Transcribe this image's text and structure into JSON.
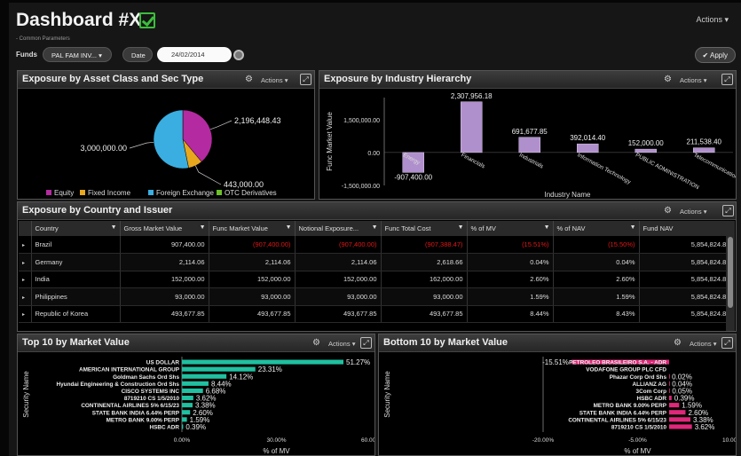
{
  "header": {
    "title": "Dashboard #X",
    "actions_label": "Actions"
  },
  "params": {
    "common_label": "Common Parameters",
    "funds_label": "Funds",
    "funds_value": "PAL FAM INV...",
    "date_label": "Date",
    "date_value": "24/02/2014",
    "apply_label": "Apply"
  },
  "panels": {
    "asset": {
      "title": "Exposure by Asset Class and Sec Type",
      "actions": "Actions"
    },
    "industry": {
      "title": "Exposure by Industry Hierarchy",
      "actions": "Actions"
    },
    "country": {
      "title": "Exposure by Country and Issuer",
      "actions": "Actions"
    },
    "top10": {
      "title": "Top 10 by Market Value",
      "actions": "Actions"
    },
    "bottom10": {
      "title": "Bottom 10 by Market Value",
      "actions": "Actions"
    }
  },
  "colors": {
    "equity": "#b42aa0",
    "fixed_income": "#e8a81e",
    "fx": "#3aaee0",
    "otc": "#6cc027",
    "industry_bar": "#b090cc",
    "top_bar": "#20c0a0",
    "bottom_bar": "#e0287a"
  },
  "table": {
    "columns": [
      "Country",
      "Gross Market Value",
      "Func Market Value",
      "Notional Exposure...",
      "Func Total Cost",
      "% of MV",
      "% of NAV",
      "Fund NAV"
    ],
    "rows": [
      {
        "country": "Brazil",
        "gmv": "907,400.00",
        "fmv": "(907,400.00)",
        "notional": "(907,400.00)",
        "cost": "(907,388.47)",
        "pmv": "(15.51%)",
        "pnav": "(15.50%)",
        "nav": "5,854,824.82",
        "neg": true
      },
      {
        "country": "Germany",
        "gmv": "2,114.06",
        "fmv": "2,114.06",
        "notional": "2,114.06",
        "cost": "2,618.66",
        "pmv": "0.04%",
        "pnav": "0.04%",
        "nav": "5,854,824.82",
        "neg": false
      },
      {
        "country": "India",
        "gmv": "152,000.00",
        "fmv": "152,000.00",
        "notional": "152,000.00",
        "cost": "162,000.00",
        "pmv": "2.60%",
        "pnav": "2.60%",
        "nav": "5,854,824.82",
        "neg": false
      },
      {
        "country": "Philippines",
        "gmv": "93,000.00",
        "fmv": "93,000.00",
        "notional": "93,000.00",
        "cost": "93,000.00",
        "pmv": "1.59%",
        "pnav": "1.59%",
        "nav": "5,854,824.82",
        "neg": false
      },
      {
        "country": "Republic of Korea",
        "gmv": "493,677.85",
        "fmv": "493,677.85",
        "notional": "493,677.85",
        "cost": "493,677.85",
        "pmv": "8.44%",
        "pnav": "8.43%",
        "nav": "5,854,824.82",
        "neg": false
      }
    ]
  },
  "chart_data": [
    {
      "type": "pie",
      "labels": [
        "Equity",
        "Fixed Income",
        "Foreign Exchange",
        "OTC Derivatives"
      ],
      "values": [
        2196448.43,
        443000.0,
        3000000.0,
        0
      ],
      "data_labels": [
        "2,196,448.43",
        "443,000.00",
        "3,000,000.00"
      ],
      "legend": "bottom"
    },
    {
      "type": "bar",
      "categories": [
        "Energy",
        "Financials",
        "Industrials",
        "Information Technology",
        "PUBLIC ADMINISTRATION",
        "Telecommunication Servic"
      ],
      "values": [
        -907400.0,
        2307956.18,
        691677.85,
        392014.4,
        152000.0,
        211538.4
      ],
      "data_labels": [
        "-907,400.00",
        "2,307,956.18",
        "691,677.85",
        "392,014.40",
        "152,000.00",
        "211,538.40"
      ],
      "xlabel": "Industry Name",
      "ylabel": "Func Market Value",
      "yticks": [
        "1,500,000.00",
        "0.00",
        "-1,500,000.00"
      ],
      "ylim": [
        -1500000,
        2500000
      ]
    },
    {
      "type": "bar",
      "orientation": "horizontal",
      "categories": [
        "US DOLLAR",
        "AMERICAN INTERNATIONAL GROUP",
        "Goldman Sachs Ord Shs",
        "Hyundai Engineering & Construction Ord Shs",
        "CISCO SYSTEMS INC",
        "8719210 CS 1/5/2010",
        "CONTINENTAL AIRLINES 5% 6/15/23",
        "STATE BANK INDIA 6.44% PERP",
        "METRO BANK 9.00% PERP",
        "HSBC ADR"
      ],
      "values": [
        51.27,
        23.31,
        14.12,
        8.44,
        6.68,
        3.62,
        3.38,
        2.6,
        1.59,
        0.39
      ],
      "data_labels": [
        "51.27%",
        "23.31%",
        "14.12%",
        "8.44%",
        "6.68%",
        "3.62%",
        "3.38%",
        "2.60%",
        "1.59%",
        "0.39%"
      ],
      "xlabel": "% of MV",
      "ylabel": "Security Name",
      "xticks": [
        "0.00%",
        "30.00%",
        "60.00%"
      ],
      "xlim": [
        0,
        60
      ]
    },
    {
      "type": "bar",
      "orientation": "horizontal",
      "categories": [
        "PETROLEO BRASILEIRO S.A. - ADR",
        "VODAFONE GROUP PLC CFD",
        "Phazar Corp Ord Shs",
        "ALLIANZ AG",
        "3Com Corp",
        "HSBC ADR",
        "METRO BANK 9.00% PERP",
        "STATE BANK INDIA 6.44% PERP",
        "CONTINENTAL AIRLINES 5% 6/15/23",
        "8719210 CS 1/5/2010"
      ],
      "values": [
        -15.51,
        0,
        0.02,
        0.04,
        0.05,
        0.39,
        1.59,
        2.6,
        3.38,
        3.62
      ],
      "data_labels": [
        "-15.51%",
        "",
        "0.02%",
        "0.04%",
        "0.05%",
        "0.39%",
        "1.59%",
        "2.60%",
        "3.38%",
        "3.62%"
      ],
      "xlabel": "% of MV",
      "ylabel": "Security Name",
      "xticks": [
        "-20.00%",
        "-5.00%",
        "10.00%"
      ],
      "xlim": [
        -20,
        10
      ]
    }
  ]
}
